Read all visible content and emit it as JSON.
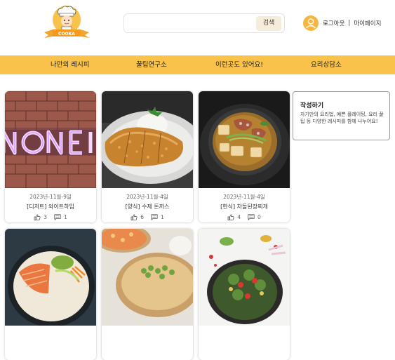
{
  "header": {
    "logo_text": "COOKA",
    "search": {
      "placeholder": "",
      "button_label": "검색"
    },
    "user": {
      "logout_label": "로그아웃",
      "separator": "|",
      "mypage_label": "마이페이지"
    }
  },
  "nav": {
    "items": [
      {
        "label": "나만의 레시피"
      },
      {
        "label": "꿀팁연구소"
      },
      {
        "label": "이런곳도 있어요!"
      },
      {
        "label": "요리상담소"
      }
    ]
  },
  "cards": [
    {
      "date": "2023년-11월-9일",
      "title": "[디저트] 와이트하임",
      "likes": "3",
      "comments": "1"
    },
    {
      "date": "2023년-11월-4일",
      "title": "[양식] 수제 돈까스",
      "likes": "6",
      "comments": "1"
    },
    {
      "date": "2023년-11월-4일",
      "title": "[한식] 차돌된장찌개",
      "likes": "4",
      "comments": "0"
    }
  ],
  "write_box": {
    "title": "작성하기",
    "description": "자기만의 요리법, 예쁜 플레이팅, 요리 꿀팁 등 다양한 레시피를 함께 나누어요!"
  },
  "colors": {
    "accent": "#f8c24b",
    "avatar": "#f6b63f",
    "button_bg": "#f5ecd9"
  }
}
